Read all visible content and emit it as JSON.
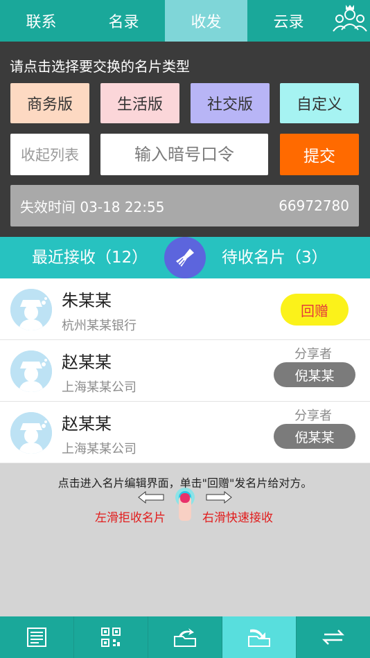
{
  "tabs": [
    {
      "label": "联系",
      "active": false
    },
    {
      "label": "名录",
      "active": false
    },
    {
      "label": "收发",
      "active": true
    },
    {
      "label": "云录",
      "active": false
    }
  ],
  "panel": {
    "title": "请点击选择要交换的名片类型",
    "types": [
      "商务版",
      "生活版",
      "社交版",
      "自定义"
    ],
    "collapse_label": "收起列表",
    "code_placeholder": "输入暗号口令",
    "submit_label": "提交",
    "expire_text": "失效时间 03-18 22:55",
    "code_number": "66972780"
  },
  "status": {
    "recent": "最近接收（12）",
    "pending": "待收名片（3）"
  },
  "list": [
    {
      "name": "朱某某",
      "company": "杭州某某银行",
      "action": "回赠"
    },
    {
      "name": "赵某某",
      "company": "上海某某公司",
      "sharer_label": "分享者",
      "sharer": "倪某某"
    },
    {
      "name": "赵某某",
      "company": "上海某某公司",
      "sharer_label": "分享者",
      "sharer": "倪某某"
    }
  ],
  "hint": {
    "line": "点击进入名片编辑界面，单击\"回赠\"发名片给对方。",
    "left": "左滑拒收名片",
    "right": "右滑快速接收"
  },
  "bottom_nav": [
    "card-list-icon",
    "qr-code-icon",
    "share-folder-icon",
    "receive-folder-icon",
    "exchange-arrows-icon"
  ],
  "colors": {
    "teal": "#1aa89a",
    "active_tab": "#7fd6d8",
    "submit": "#ff6a00",
    "status_bar": "#27c2c0"
  }
}
